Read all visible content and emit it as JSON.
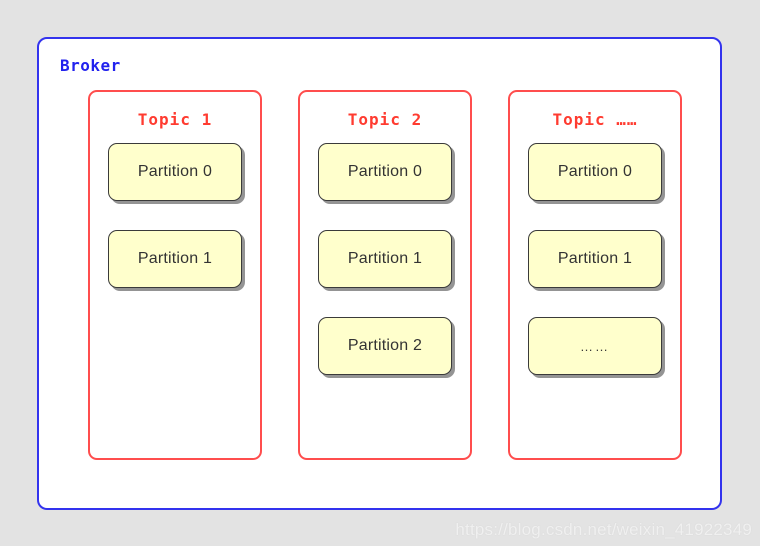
{
  "diagram": {
    "background_color": "#e3e3e3",
    "broker": {
      "label": "Broker",
      "border_color": "#3333ee",
      "label_color": "#2222ee",
      "fill_color": "#ffffff"
    },
    "topic_style": {
      "border_color": "#ff4d4d",
      "title_color": "#ff3b30",
      "fill_color": "#ffffff"
    },
    "partition_style": {
      "fill_color": "#ffffcc",
      "border_color": "#3a3a3a",
      "text_color": "#333333"
    },
    "topics": [
      {
        "title": "Topic 1",
        "partitions": [
          {
            "label": "Partition 0"
          },
          {
            "label": "Partition 1"
          }
        ]
      },
      {
        "title": "Topic 2",
        "partitions": [
          {
            "label": "Partition 0"
          },
          {
            "label": "Partition 1"
          },
          {
            "label": "Partition 2"
          }
        ]
      },
      {
        "title": "Topic ……",
        "partitions": [
          {
            "label": "Partition 0"
          },
          {
            "label": "Partition 1"
          },
          {
            "label": "……"
          }
        ]
      }
    ]
  },
  "watermark": {
    "text": "https://blog.csdn.net/weixin_41922349",
    "color": "#f0f0f0"
  }
}
